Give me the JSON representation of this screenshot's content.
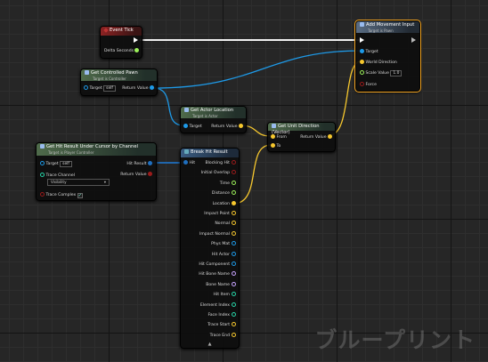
{
  "event_tick": {
    "title": "Event Tick",
    "pin_delta": "Delta Seconds",
    "icon": "event-diamond-icon",
    "color": "#8c2323"
  },
  "get_controlled_pawn": {
    "title": "Get Controlled Pawn",
    "subtitle": "Target is Controller",
    "pin_target": "Target",
    "target_value": "self",
    "pin_return": "Return Value"
  },
  "add_movement_input": {
    "title": "Add Movement Input",
    "subtitle": "Target is Pawn",
    "pin_target": "Target",
    "pin_world_direction": "World Direction",
    "pin_scale_value": "Scale Value",
    "scale_value": "1.0",
    "pin_force": "Force"
  },
  "get_actor_location": {
    "title": "Get Actor Location",
    "subtitle": "Target is Actor",
    "pin_target": "Target",
    "pin_return": "Return Value"
  },
  "get_unit_direction": {
    "title": "Get Unit Direction (Vector)",
    "pin_from": "From",
    "pin_to": "To",
    "pin_return": "Return Value"
  },
  "hit_result_under_cursor": {
    "title": "Get Hit Result Under Cursor by Channel",
    "subtitle": "Target is Player Controller",
    "pin_target": "Target",
    "target_value": "self",
    "pin_trace_channel": "Trace Channel",
    "trace_channel_value": "Visibility",
    "pin_trace_complex": "Trace Complex",
    "pin_hit_result": "Hit Result",
    "pin_return": "Return Value"
  },
  "break_hit_result": {
    "title": "Break Hit Result",
    "pin_hit": "Hit",
    "outputs": [
      "Blocking Hit",
      "Initial Overlap",
      "Time",
      "Distance",
      "Location",
      "Impact Point",
      "Normal",
      "Impact Normal",
      "Phys Mat",
      "Hit Actor",
      "Hit Component",
      "Hit Bone Name",
      "Bone Name",
      "Hit Item",
      "Element Index",
      "Face Index",
      "Trace Start",
      "Trace End"
    ]
  },
  "watermark": "ブループリント",
  "colors": {
    "exec": "#ffffff",
    "object": "#1e9ae8",
    "vector": "#f7c82e",
    "bool": "#9a1b1b",
    "float": "#9cf05a",
    "struct": "#1f6fbf",
    "name": "#c8a3ff",
    "int": "#27d6a8",
    "selected": "#f5a623"
  }
}
